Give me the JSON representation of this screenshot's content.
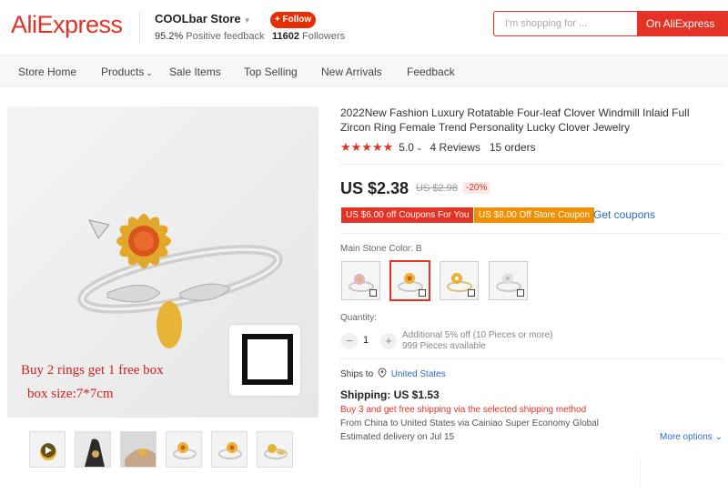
{
  "header": {
    "logo": "AliExpress",
    "store_name": "COOLbar Store",
    "feedback_pct": "95.2%",
    "feedback_label": "Positive feedback",
    "follow_label": "+ Follow",
    "followers_count": "11602",
    "followers_label": "Followers",
    "search_placeholder": "I'm shopping for ...",
    "search_button": "On AliExpress"
  },
  "nav": {
    "items": [
      "Store Home",
      "Products",
      "Sale Items",
      "Top Selling",
      "New Arrivals",
      "Feedback"
    ]
  },
  "gallery": {
    "promo_line1": "Buy 2 rings get 1 free box",
    "promo_line2": "box size:7*7cm",
    "thumb_count": 6
  },
  "product": {
    "title": "2022New Fashion Luxury Rotatable Four-leaf Clover Windmill Inlaid Full Zircon Ring Female Trend Personality Lucky Clover Jewelry",
    "stars": "★★★★★",
    "rating": "5.0",
    "reviews": "4 Reviews",
    "orders": "15 orders",
    "price": "US $2.38",
    "old_price": "US $2.98",
    "discount": "-20%",
    "coupon_1": "US $6.00 off Coupons For You",
    "coupon_2": "US $8.00 Off Store Coupon",
    "get_coupons": "Get coupons",
    "color_label": "Main Stone Color:",
    "color_value": "B",
    "quantity_label": "Quantity:",
    "quantity": "1",
    "qty_minus": "−",
    "qty_plus": "+",
    "qty_note1": "Additional 5% off (10 Pieces or more)",
    "qty_note2": "999 Pieces available",
    "ships_to_label": "Ships to",
    "ships_to_location": "United States",
    "shipping": "Shipping: US $1.53",
    "shipping_note": "Buy 3 and get free shipping via the selected shipping method",
    "shipping_route": "From China to United States via Cainiao Super Economy Global",
    "delivery": "Estimated delivery on Jul 15",
    "more_options": "More options"
  },
  "colors": {
    "brand": "#e43225",
    "link": "#2e6bc4",
    "coupon_orange": "#f29005"
  }
}
